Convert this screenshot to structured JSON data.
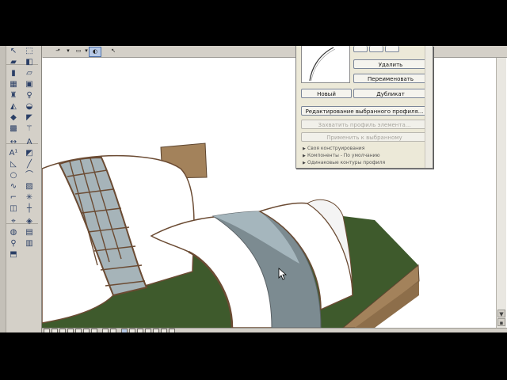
{
  "profile_panel": {
    "buttons": {
      "delete": "Удалить",
      "rename": "Переименовать",
      "new": "Новый",
      "duplicate": "Дубликат",
      "edit_selected": "Редактирование выбранного профиля...",
      "capture_element": "Захватить профиль элемента...",
      "apply_selected": "Применить к выбранному"
    },
    "sections": [
      "Своя конструирования",
      "Компоненты - По умолчанию",
      "Одинаковые контуры профиля"
    ]
  },
  "toolbar": {
    "icons": [
      "view-arrow-icon",
      "rectangle-select-icon",
      "paint-bucket-icon",
      "pointer-icon"
    ],
    "active": "paint-bucket-icon"
  },
  "toolbox": {
    "icons": [
      "arrow-icon",
      "marquee-icon",
      "wall-icon",
      "column-icon",
      "beam-icon",
      "slab-icon",
      "door-icon",
      "window-icon",
      "object-icon",
      "lamp-icon",
      "roof-icon",
      "shell-icon",
      "mesh-icon",
      "stair-icon",
      "curtain-wall-icon",
      "morph-icon",
      "dimension-icon",
      "text-icon",
      "label-icon",
      "line-icon",
      "circle-icon",
      "arc-icon",
      "polyline-icon",
      "figure-icon",
      "section-icon",
      "elevation-icon",
      "detail-icon",
      "worksheet-icon",
      "camera-icon",
      "zone-icon"
    ]
  },
  "colors": {
    "sky": "#ffffff",
    "grass": "#3e5a2c",
    "earth": "#a3825b",
    "shell": "#ffffff",
    "glass": "#98a6ac",
    "frame": "#6b4b33",
    "selected_band": "#7c8b91"
  }
}
